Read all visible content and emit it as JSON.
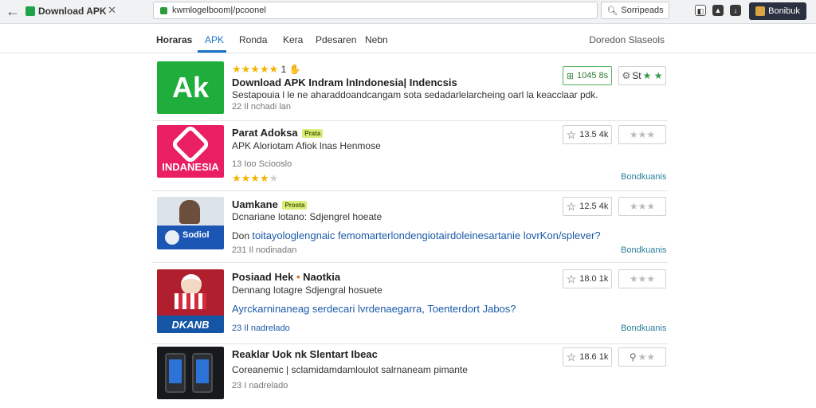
{
  "browser": {
    "tab_title": "Download APK",
    "tab_close": "✕",
    "back": "←",
    "address": "kwmlogelboom|/pcoonel",
    "search_label": "Sorripeads",
    "profile_label": "Bonibuk"
  },
  "nav": {
    "items": [
      "Horaras",
      "APK",
      "Ronda",
      "Kera",
      "Pdesaren",
      "Nebn"
    ],
    "right": "Doredon Slaseols"
  },
  "rows": [
    {
      "title": "Download APK Indram lnIndonesia| Indencsis",
      "stars_text": "★★★★★",
      "stars_count": "1",
      "desc": "Sestapouia l le ne aharaddoandcangam sota sedadarlelarcheing oarl la keacclaar pdk.",
      "meta": "22 Il nchadi lan",
      "count": "1045 8s",
      "rate": "St"
    },
    {
      "title": "Parat Adoksa",
      "tag": "Prata",
      "desc": "APK Aloriotam Afiok lnas Henmose",
      "meta": "13 Ioo Sciooslo",
      "stars_text": "★★★★",
      "stars_off": "★",
      "count": "13.5 4k",
      "rate": "★★★",
      "link": "Bondkuanis",
      "thumb_text": "INDANESIA"
    },
    {
      "title": "Uamkane",
      "tag": "Prosta",
      "desc": "Dcnariane lotano: Sdjengrel hoeate",
      "question_prefix": "Don",
      "question": "toitayologlengnaic femomarterlondengiotairdoleinesartanie lovrKon/splever?",
      "meta": "231 Il nodinadan",
      "count": "12.5 4k",
      "rate": "★★★",
      "link": "Bondkuanis",
      "thumb_text": "Sodiol"
    },
    {
      "title": "Posiaad Hek",
      "title_suffix": "Naotkia",
      "desc": "Dennang lotagre Sdjengral hosuete",
      "question": "Ayrckarninaneag serdecari lvrdenaegarra, Toenterdort Jabos?",
      "meta": "23 Il nadrelado",
      "count": "18.0 1k",
      "rate": "★★★",
      "link": "Bondkuanis",
      "thumb_text": "DKANB"
    },
    {
      "title": "Reaklar Uok nk Slentart Ibeac",
      "desc": "Coreanemic | sclamidamdamloulot salrnaneam pimante",
      "meta": "23 I nadrelado",
      "count": "18.6 1k",
      "rate": "★★",
      "thumb_text": ""
    }
  ]
}
